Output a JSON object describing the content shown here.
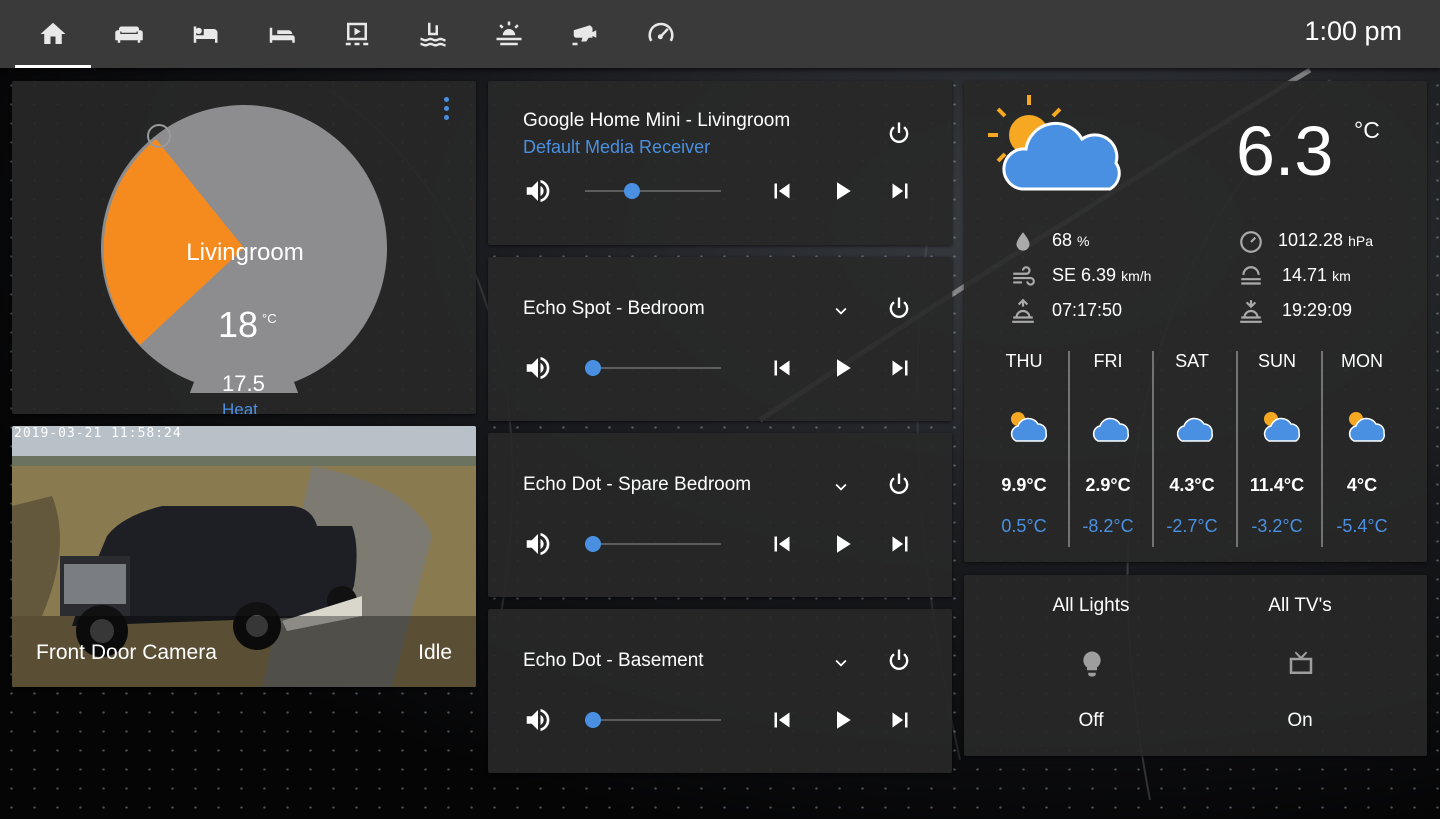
{
  "topbar": {
    "tabs": [
      {
        "icon": "home-icon",
        "active": true
      },
      {
        "icon": "sofa-icon",
        "active": false
      },
      {
        "icon": "bed-icon",
        "active": false
      },
      {
        "icon": "bed-empty-icon",
        "active": false
      },
      {
        "icon": "theater-icon",
        "active": false
      },
      {
        "icon": "pool-icon",
        "active": false
      },
      {
        "icon": "weather-sunset-icon",
        "active": false
      },
      {
        "icon": "cctv-icon",
        "active": false
      },
      {
        "icon": "speedometer-icon",
        "active": false
      }
    ],
    "clock": "1:00 pm"
  },
  "thermostat": {
    "room": "Livingroom",
    "current_temp": "18",
    "unit": "°C",
    "target_temp": "17.5",
    "mode": "Heat",
    "mode_icons": [
      "power-icon",
      "fire-icon",
      "snowflake-icon",
      "autorenew-icon",
      "leaf-icon"
    ],
    "active_mode_color": "#f58b1f"
  },
  "camera": {
    "name": "Front Door Camera",
    "state": "Idle",
    "timestamp": "2019-03-21  11:58:24"
  },
  "media_players": [
    {
      "title": "Google Home Mini - Livingroom",
      "subtitle": "Default Media Receiver",
      "volume": 0.4,
      "has_dropdown": false
    },
    {
      "title": "Echo Spot - Bedroom",
      "subtitle": "",
      "volume": 0.0,
      "has_dropdown": true
    },
    {
      "title": "Echo Dot - Spare Bedroom",
      "subtitle": "",
      "volume": 0.0,
      "has_dropdown": true
    },
    {
      "title": "Echo Dot - Basement",
      "subtitle": "",
      "volume": 0.0,
      "has_dropdown": true
    }
  ],
  "weather": {
    "temperature": "6.3",
    "unit": "°C",
    "humidity": "68",
    "humidity_unit": "%",
    "pressure": "1012.28",
    "pressure_unit": "hPa",
    "wind": "SE 6.39",
    "wind_unit": "km/h",
    "visibility": "14.71",
    "visibility_unit": "km",
    "sunrise": "07:17:50",
    "sunset": "19:29:09",
    "forecast": [
      {
        "day": "THU",
        "high": "9.9°C",
        "low": "0.5°C",
        "icon": "partly-cloudy-icon"
      },
      {
        "day": "FRI",
        "high": "2.9°C",
        "low": "-8.2°C",
        "icon": "cloudy-icon"
      },
      {
        "day": "SAT",
        "high": "4.3°C",
        "low": "-2.7°C",
        "icon": "cloudy-icon"
      },
      {
        "day": "SUN",
        "high": "11.4°C",
        "low": "-3.2°C",
        "icon": "partly-cloudy-icon"
      },
      {
        "day": "MON",
        "high": "4°C",
        "low": "-5.4°C",
        "icon": "partly-cloudy-icon"
      }
    ]
  },
  "glance": [
    {
      "name": "All Lights",
      "state": "Off",
      "icon": "lightbulb-icon"
    },
    {
      "name": "All TV's",
      "state": "On",
      "icon": "tv-icon"
    }
  ],
  "colors": {
    "accent": "#4a90e2",
    "heat": "#f58b1f",
    "card": "#282828",
    "topbar": "#3a3a3a"
  }
}
